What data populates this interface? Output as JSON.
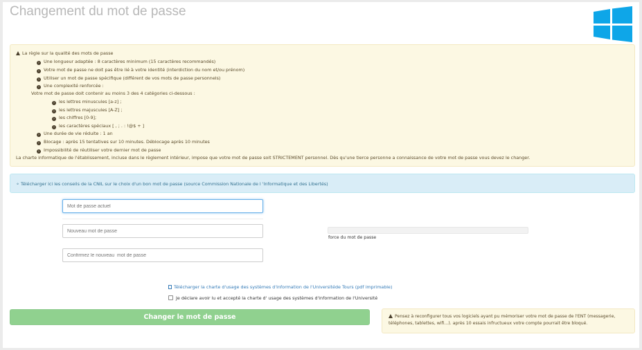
{
  "header": {
    "title": "Changement du mot de passe",
    "logo_icon": "windows-logo-icon",
    "logo_color": "#0ea6e8"
  },
  "rules": {
    "heading": "La règle sur la qualité des mots de passe",
    "items": [
      "Une longueur adaptée : 8 caractères minimum (15 caractères recommandés)",
      "Votre mot de passe ne doit pas être lié à votre identité (interdiction du nom et/ou prénom)",
      "Utiliser un mot de passe spécifique (différent de vos mots de passe personnels)",
      "Une complexité renforcée :"
    ],
    "categories_intro": "Votre mot de passe doit contenir au moins 3 des 4 catégories ci-dessous :",
    "categories": [
      "les lettres minuscules [a-z] ;",
      "les lettres majuscules [A-Z] ;",
      "les chiffres [0-9];",
      "les caractères spéciaux [ , ; . : !@$ + ]"
    ],
    "items2": [
      "Une durée de vie réduite : 1 an",
      "Blocage : après 15 tentatives sur 10 minutes. Déblocage après 10 minutes",
      "Impossibilité de réutiliser votre dernier mot de passe"
    ],
    "footer": "La charte informatique de l'établissement, incluse dans le règlement intérieur, impose que votre mot de passe soit STRICTEMENT personnel. Dès qu'une tierce personne a connaissance de votre mot de passe vous devez le changer."
  },
  "info": {
    "text": "Télécharger ici les conseils de la CNIL sur le choix d'un bon mot de passe (source Commission Nationale de l 'Informatique et des Libertés)",
    "color": "#31708f"
  },
  "form": {
    "current_placeholder": "Mot de passe actuel",
    "new_placeholder": "Nouveau mot de passe",
    "confirm_placeholder": "Confirmez le nouveau  mot de passe",
    "strength_label": "force du mot de passe",
    "strength_level": 0,
    "charter_link": "Télécharger la charte d'usage des systèmes d'information de l'Universitéde Tours (pdf imprimable)",
    "accept_label": "Je déclare avoir lu et accepté la charte d' usage des systèmes d'information de l'Université",
    "accept_checked": false,
    "submit_label": "Changer le mot de passe",
    "submit_color": "#90d18f"
  },
  "reminder": {
    "text": "Pensez à reconfigurer tous vos logiciels ayant pu mémoriser votre mot de passe de l'ENT (messagerie, téléphones, tablettes, wifi...). après 10 essais infructueux votre compte pourrait être bloqué."
  }
}
